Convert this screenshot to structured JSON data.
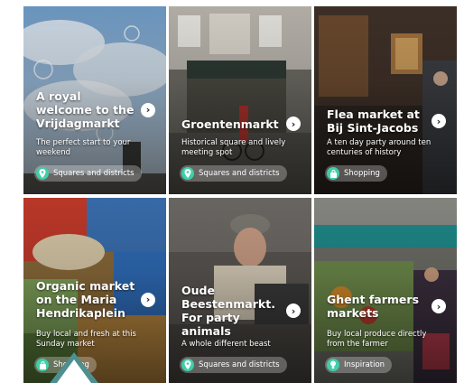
{
  "cards": [
    {
      "title": "A royal welcome to the Vrijdagmarkt",
      "description": "The perfect start to your weekend",
      "category": "Squares and districts",
      "category_icon": "location-pin-icon",
      "bg": "#8fb1cf"
    },
    {
      "title": "Groentenmarkt",
      "description": "Historical square and lively meeting spot",
      "category": "Squares and districts",
      "category_icon": "location-pin-icon",
      "bg": "#6a6a64"
    },
    {
      "title": "Flea market at Bij Sint-Jacobs",
      "description": "A ten day party around ten centuries of history",
      "category": "Shopping",
      "category_icon": "shopping-bag-icon",
      "bg": "#4b3a2e"
    },
    {
      "title": "Organic market on the Maria Hendrikaplein",
      "description": "Buy local and fresh at this Sunday market",
      "category": "Shopping",
      "category_icon": "shopping-bag-icon",
      "bg": "#8a6a3a"
    },
    {
      "title": "Oude Beestenmarkt. For party animals",
      "description": "A whole different beast",
      "category": "Squares and districts",
      "category_icon": "location-pin-icon",
      "bg": "#5a5652"
    },
    {
      "title": "Ghent farmers markets",
      "description": "Buy local produce directly from the farmer",
      "category": "Inspiration",
      "category_icon": "lightbulb-icon",
      "bg": "#3d6a70"
    }
  ],
  "accent_color": "#3ecfa8",
  "overlay_icon": "play-triangle-icon"
}
